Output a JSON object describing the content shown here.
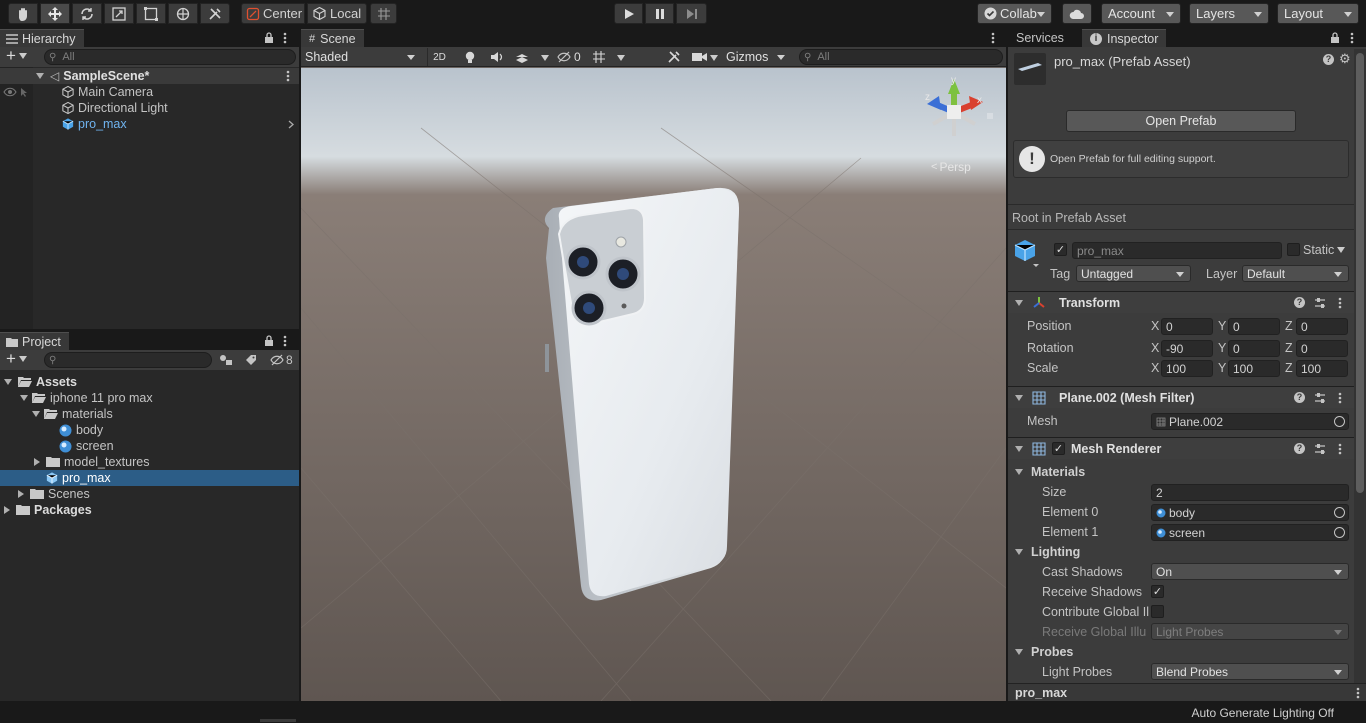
{
  "toolbar": {
    "pivot_center": "Center",
    "pivot_local": "Local",
    "collab": "Collab",
    "account": "Account",
    "layers": "Layers",
    "layout": "Layout"
  },
  "hierarchy": {
    "tab": "Hierarchy",
    "search_placeholder": "All",
    "scene": "SampleScene*",
    "items": [
      "Main Camera",
      "Directional Light",
      "pro_max"
    ]
  },
  "scene": {
    "tab": "Scene",
    "shading": "Shaded",
    "mode_2d": "2D",
    "hidden_count": "0",
    "gizmos": "Gizmos",
    "search_placeholder": "All",
    "persp": "Persp",
    "axis_y": "y",
    "axis_x": "x",
    "axis_z": "z"
  },
  "project": {
    "tab": "Project",
    "hidden_count": "8",
    "tree": {
      "assets": "Assets",
      "iphone": "iphone 11 pro max",
      "materials": "materials",
      "body": "body",
      "screen": "screen",
      "model_textures": "model_textures",
      "pro_max": "pro_max",
      "scenes": "Scenes",
      "packages": "Packages"
    }
  },
  "inspector": {
    "tab_services": "Services",
    "tab_inspector": "Inspector",
    "title": "pro_max (Prefab Asset)",
    "open_prefab": "Open Prefab",
    "info": "Open Prefab for full editing support.",
    "root_label": "Root in Prefab Asset",
    "object_name": "pro_max",
    "static": "Static",
    "tag_label": "Tag",
    "tag_value": "Untagged",
    "layer_label": "Layer",
    "layer_value": "Default",
    "transform": {
      "title": "Transform",
      "position_label": "Position",
      "rotation_label": "Rotation",
      "scale_label": "Scale",
      "x": "X",
      "y": "Y",
      "z": "Z",
      "position": [
        "0",
        "0",
        "0"
      ],
      "rotation": [
        "-90",
        "0",
        "0"
      ],
      "scale": [
        "100",
        "100",
        "100"
      ]
    },
    "mesh_filter": {
      "title": "Plane.002 (Mesh Filter)",
      "mesh_label": "Mesh",
      "mesh_value": "Plane.002"
    },
    "mesh_renderer": {
      "title": "Mesh Renderer",
      "materials": "Materials",
      "size_label": "Size",
      "size_value": "2",
      "element0_label": "Element 0",
      "element0_value": "body",
      "element1_label": "Element 1",
      "element1_value": "screen",
      "lighting": "Lighting",
      "cast_shadows_label": "Cast Shadows",
      "cast_shadows_value": "On",
      "receive_shadows_label": "Receive Shadows",
      "contribute_gi_label": "Contribute Global Il",
      "receive_gi_label": "Receive Global Illu",
      "receive_gi_value": "Light Probes",
      "probes": "Probes",
      "light_probes_label": "Light Probes",
      "light_probes_value": "Blend Probes"
    },
    "footer": "pro_max"
  },
  "status": {
    "auto_lighting": "Auto Generate Lighting Off"
  }
}
